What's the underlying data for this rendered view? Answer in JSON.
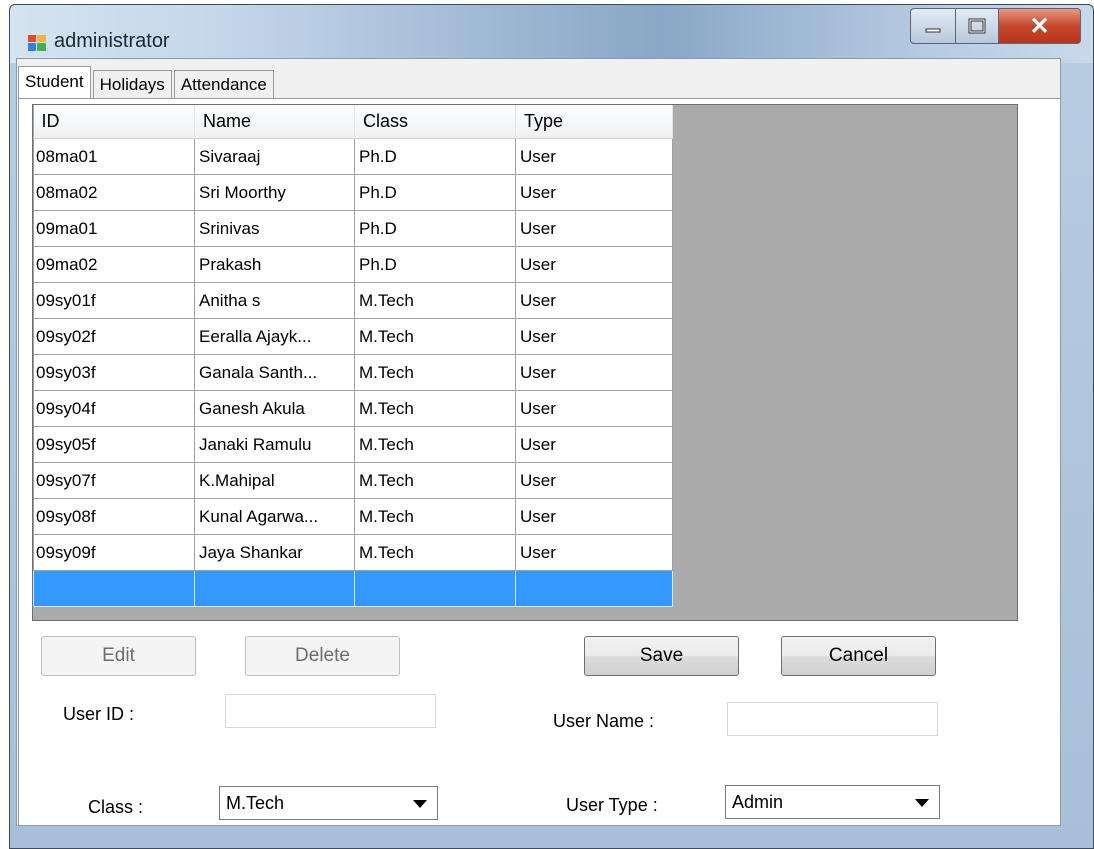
{
  "window": {
    "title": "administrator"
  },
  "tabs": [
    {
      "label": "Student",
      "active": true
    },
    {
      "label": "Holidays",
      "active": false
    },
    {
      "label": "Attendance",
      "active": false
    }
  ],
  "grid": {
    "columns": [
      "ID",
      "Name",
      "Class",
      "Type"
    ],
    "rows": [
      [
        "08ma01",
        "Sivaraaj",
        "Ph.D",
        "User"
      ],
      [
        "08ma02",
        "Sri Moorthy",
        "Ph.D",
        "User"
      ],
      [
        "09ma01",
        "Srinivas",
        "Ph.D",
        "User"
      ],
      [
        "09ma02",
        "Prakash",
        "Ph.D",
        "User"
      ],
      [
        "09sy01f",
        "Anitha s",
        "M.Tech",
        "User"
      ],
      [
        "09sy02f",
        "Eeralla  Ajayk...",
        "M.Tech",
        "User"
      ],
      [
        "09sy03f",
        "Ganala Santh...",
        "M.Tech",
        "User"
      ],
      [
        "09sy04f",
        "Ganesh Akula",
        "M.Tech",
        "User"
      ],
      [
        "09sy05f",
        "Janaki Ramulu",
        "M.Tech",
        "User"
      ],
      [
        "09sy07f",
        "K.Mahipal",
        "M.Tech",
        "User"
      ],
      [
        "09sy08f",
        "Kunal Agarwa...",
        "M.Tech",
        "User"
      ],
      [
        "09sy09f",
        "Jaya Shankar",
        "M.Tech",
        "User"
      ]
    ],
    "selection_color": "#3399ff"
  },
  "buttons": {
    "edit": "Edit",
    "delete": "Delete",
    "save": "Save",
    "cancel": "Cancel"
  },
  "form": {
    "user_id_label": "User ID :",
    "user_id_value": "",
    "user_name_label": "User Name :",
    "user_name_value": "",
    "class_label": "Class :",
    "class_value": "M.Tech",
    "user_type_label": "User Type :",
    "user_type_value": "Admin"
  }
}
